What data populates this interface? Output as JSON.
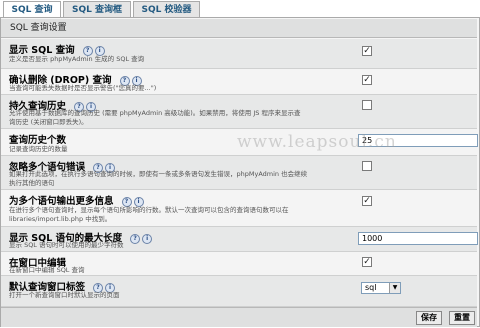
{
  "tabs": [
    {
      "label": "SQL 查询"
    },
    {
      "label": "SQL 查询框"
    },
    {
      "label": "SQL 校验器"
    }
  ],
  "section_title": "SQL 查询设置",
  "icons": {
    "docs": "doc-icon",
    "info": "info-icon"
  },
  "rows": [
    {
      "title": "显示 SQL 查询",
      "desc": "定义是否显示 phpMyAdmin 生成的 SQL 查询",
      "control": "checkbox",
      "checked": true
    },
    {
      "title": "确认删除 (DROP) 查询",
      "desc": "当查询可能丢失数据时是否显示警告(\"您真的要...\")",
      "control": "checkbox",
      "checked": true
    },
    {
      "title": "持久查询历史",
      "desc1": "允许使用基于数据库的查询历史 (需要 phpMyAdmin 高级功能)。如果禁用，将使用 JS 程序来显示查",
      "desc2": "询历史 (关闭窗口即丢失)。",
      "control": "checkbox",
      "checked": false
    },
    {
      "title": "查询历史个数",
      "desc": "记录查询历史的数量",
      "control": "number",
      "value": "25"
    },
    {
      "title": "忽略多个语句错误",
      "desc1": "如果打开此选项，在执行多语句查询的时候，即使有一条或多条语句发生错误，phpMyAdmin 也会继续",
      "desc2": "执行其他的语句",
      "control": "checkbox",
      "checked": false
    },
    {
      "title": "为多个语句输出更多信息",
      "desc1": "在进行多个语句查询时，显示每个语句所影响的行数。默认一次查询可以包含的查询语句数可以在",
      "desc2": "libraries/import.lib.php 中找到。",
      "control": "checkbox",
      "checked": true
    },
    {
      "title": "显示 SQL 语句的最大长度",
      "desc": "显示 SQL 语句时可以使用的最少字符数",
      "control": "number",
      "value": "1000"
    },
    {
      "title": "在窗口中编辑",
      "desc": "在新窗口中编辑 SQL 查询",
      "control": "checkbox",
      "checked": true
    },
    {
      "title": "默认查询窗口标签",
      "desc": "打开一个新查询窗口时默认显示的页面",
      "control": "select",
      "value": "sql"
    }
  ],
  "watermark": "www.leapsoul.cn",
  "buttons": {
    "save": "保存",
    "reset": "重置"
  }
}
